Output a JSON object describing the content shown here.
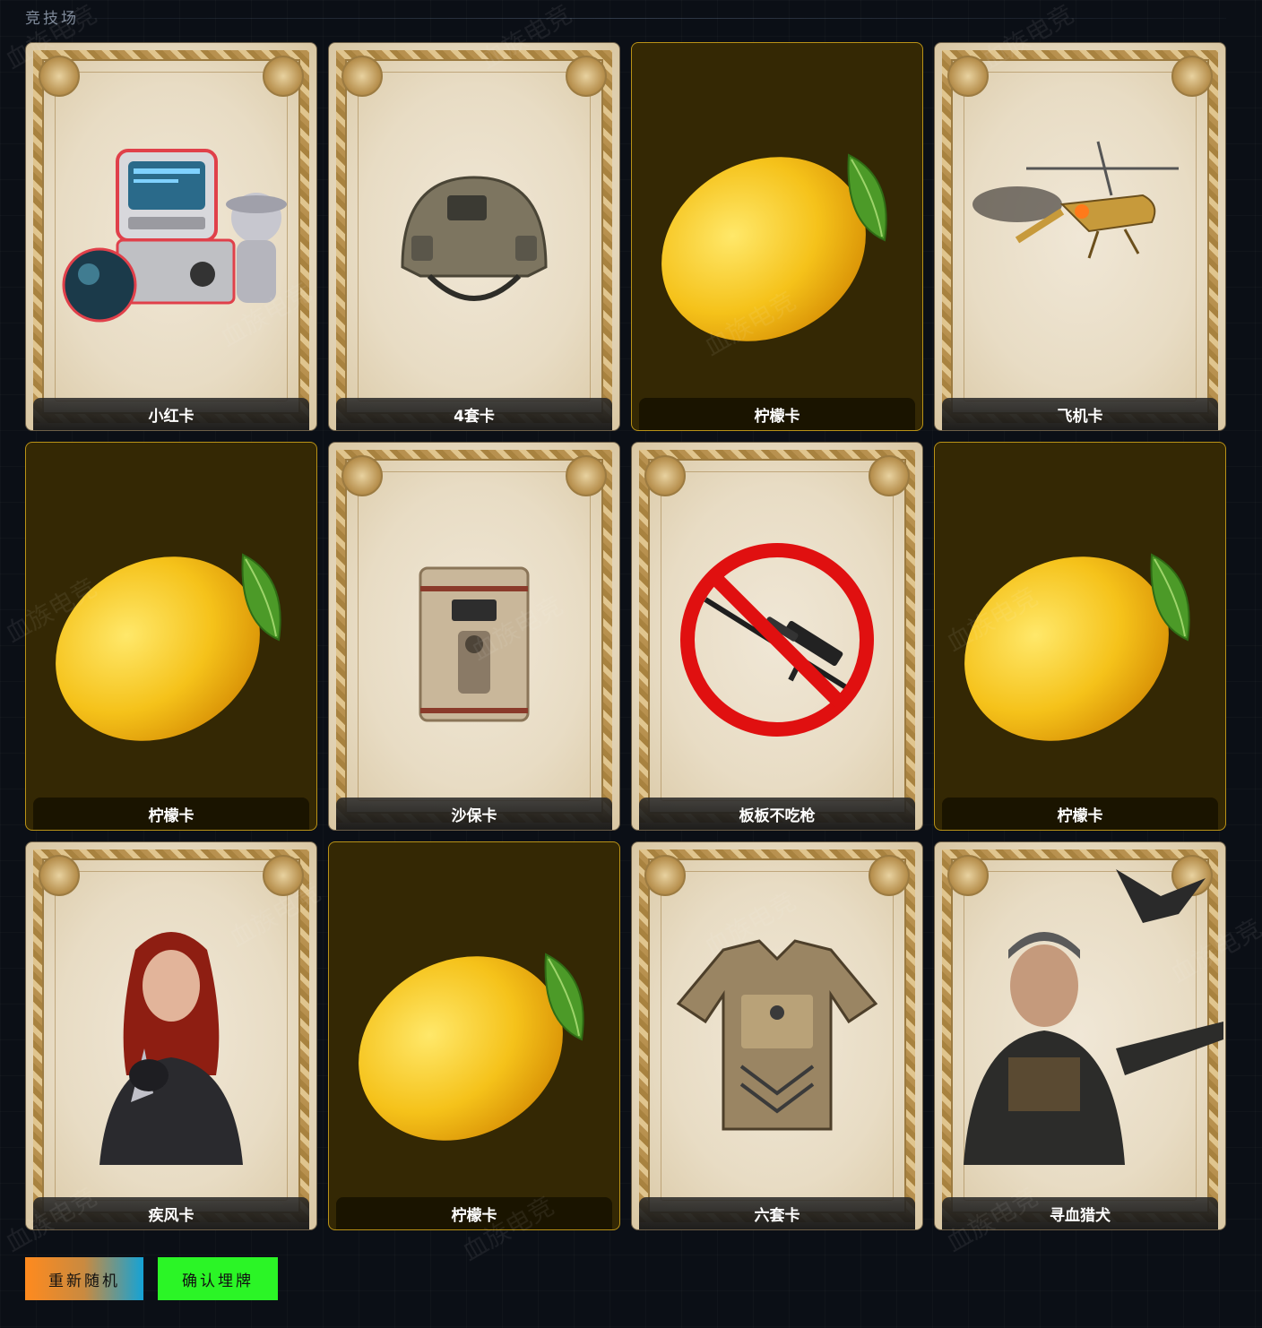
{
  "header": {
    "title": "竞技场"
  },
  "watermark_text": "血族电竞",
  "cards": [
    {
      "label": "小红卡",
      "style": "ornate",
      "icon": "red-card-machine-icon"
    },
    {
      "label": "4套卡",
      "style": "ornate",
      "icon": "tactical-helmet-icon"
    },
    {
      "label": "柠檬卡",
      "style": "lemon",
      "icon": "lemon-icon"
    },
    {
      "label": "飞机卡",
      "style": "ornate",
      "icon": "helicopter-icon"
    },
    {
      "label": "柠檬卡",
      "style": "lemon",
      "icon": "lemon-icon"
    },
    {
      "label": "沙保卡",
      "style": "ornate",
      "icon": "safe-box-icon"
    },
    {
      "label": "板板不吃枪",
      "style": "ornate",
      "icon": "no-sniper-icon"
    },
    {
      "label": "柠檬卡",
      "style": "lemon",
      "icon": "lemon-icon"
    },
    {
      "label": "疾风卡",
      "style": "ornate",
      "icon": "assassin-portrait-icon"
    },
    {
      "label": "柠檬卡",
      "style": "lemon",
      "icon": "lemon-icon"
    },
    {
      "label": "六套卡",
      "style": "ornate",
      "icon": "body-armor-icon"
    },
    {
      "label": "寻血猎犬",
      "style": "ornate",
      "icon": "hunter-portrait-icon"
    }
  ],
  "buttons": {
    "reshuffle": "重新随机",
    "confirm": "确认埋牌"
  },
  "colors": {
    "lemon_card_bg": "#342804",
    "lemon_card_border": "#b99217",
    "confirm_button": "#2bf526",
    "reshuffle_gradient_start": "#ff8a1e",
    "reshuffle_gradient_end": "#14a3d6"
  }
}
